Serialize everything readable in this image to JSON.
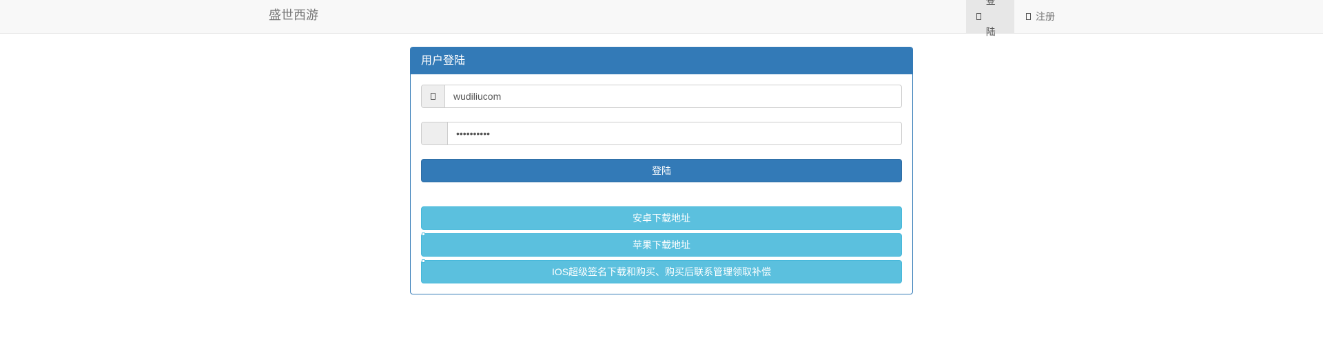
{
  "navbar": {
    "brand": "盛世西游",
    "login_label": "登陆",
    "register_label": "注册"
  },
  "panel": {
    "title": "用户登陆",
    "username_value": "wudiliucom",
    "password_value": "wudiliucom",
    "login_button": "登陆",
    "android_button": "安卓下载地址",
    "apple_button": "苹果下载地址",
    "ios_button": "IOS超级签名下载和购买、购买后联系管理领取补偿"
  },
  "icons": {
    "nav_login_icon": "login-icon",
    "nav_register_icon": "user-icon",
    "username_icon": "user-icon",
    "password_icon": "lock-icon"
  },
  "colors": {
    "primary": "#337ab7",
    "info": "#5bc0de",
    "navbar_bg": "#f8f8f8"
  }
}
